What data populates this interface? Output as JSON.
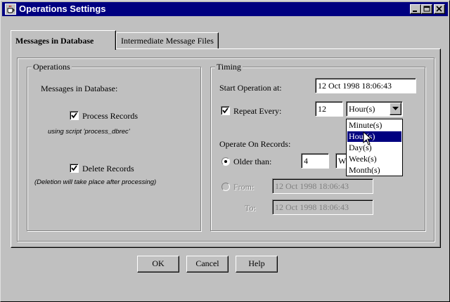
{
  "window": {
    "title": "Operations Settings"
  },
  "tabs": [
    {
      "label": "Messages in Database",
      "active": true
    },
    {
      "label": "Intermediate Message Files",
      "active": false
    }
  ],
  "operations": {
    "legend": "Operations",
    "heading": "Messages in Database:",
    "process_records": {
      "label": "Process Records",
      "checked": true,
      "note": "using script 'process_dbrec'"
    },
    "delete_records": {
      "label": "Delete Records",
      "checked": true,
      "note": "(Deletion will take place after processing)"
    }
  },
  "timing": {
    "legend": "Timing",
    "start_label": "Start Operation at:",
    "start_value": "12 Oct 1998 18:06:43",
    "repeat": {
      "label": "Repeat Every:",
      "checked": true,
      "value": "12",
      "unit": "Hour(s)"
    },
    "unit_options": [
      "Minute(s)",
      "Hour(s)",
      "Day(s)",
      "Week(s)",
      "Month(s)"
    ],
    "unit_highlighted": "Hour(s)",
    "operate_label": "Operate On Records:",
    "older_than": {
      "label": "Older than:",
      "selected": true,
      "value": "4",
      "unit_visible": "W"
    },
    "from": {
      "label": "From:",
      "selected": false,
      "value": "12 Oct 1998 18:06:43"
    },
    "to": {
      "label": "To:",
      "value": "12 Oct 1998 18:06:43"
    }
  },
  "buttons": {
    "ok": "OK",
    "cancel": "Cancel",
    "help": "Help"
  },
  "colors": {
    "titlebar": "#000080",
    "face": "#c0c0c0",
    "highlight": "#000080"
  }
}
